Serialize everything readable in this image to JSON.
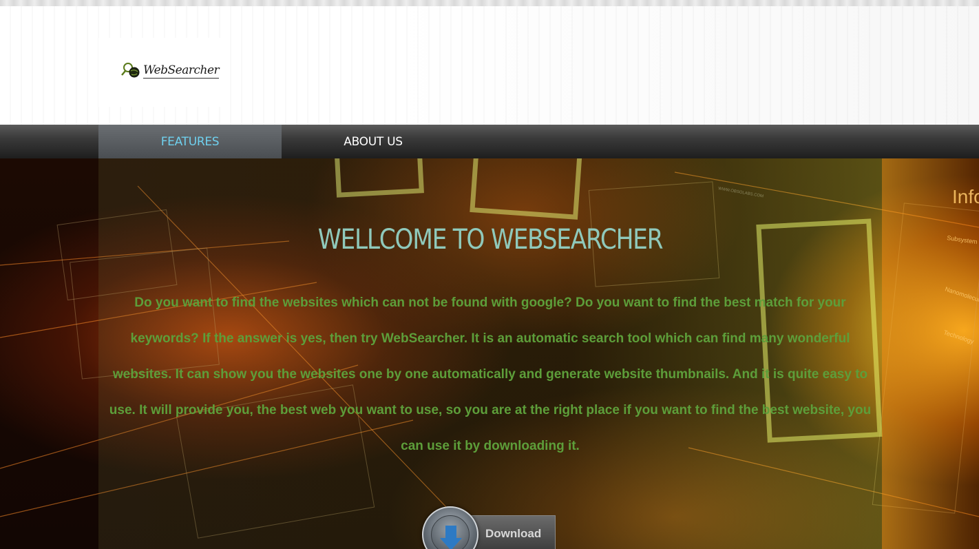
{
  "header": {
    "logo_text": "WebSearcher"
  },
  "nav": {
    "items": [
      {
        "label": "FEATURES",
        "active": true
      },
      {
        "label": "ABOUT US",
        "active": false
      }
    ]
  },
  "hero": {
    "title": "WELLCOME TO WEBSEARCHER",
    "description": "Do you want to find the websites which can not be found with google? Do you want to find the best match for your keywords? If the answer is yes, then try WebSearcher. It is an automatic search tool which can find many wonderful websites. It can show you the websites one by one automatically and generate website thumbnails. And it is quite easy to use. It will provide you, the best web you want to use, so you are at the right place if you want to find the best website, you can use it by downloading it.",
    "download_label": "Download"
  },
  "colors": {
    "nav_active_text": "#6fd0ee",
    "title_color": "#8fc9bb",
    "body_text_color": "#5d9e3a"
  },
  "icons": [
    "magnifier-globe-icon",
    "download-arrow-icon"
  ]
}
